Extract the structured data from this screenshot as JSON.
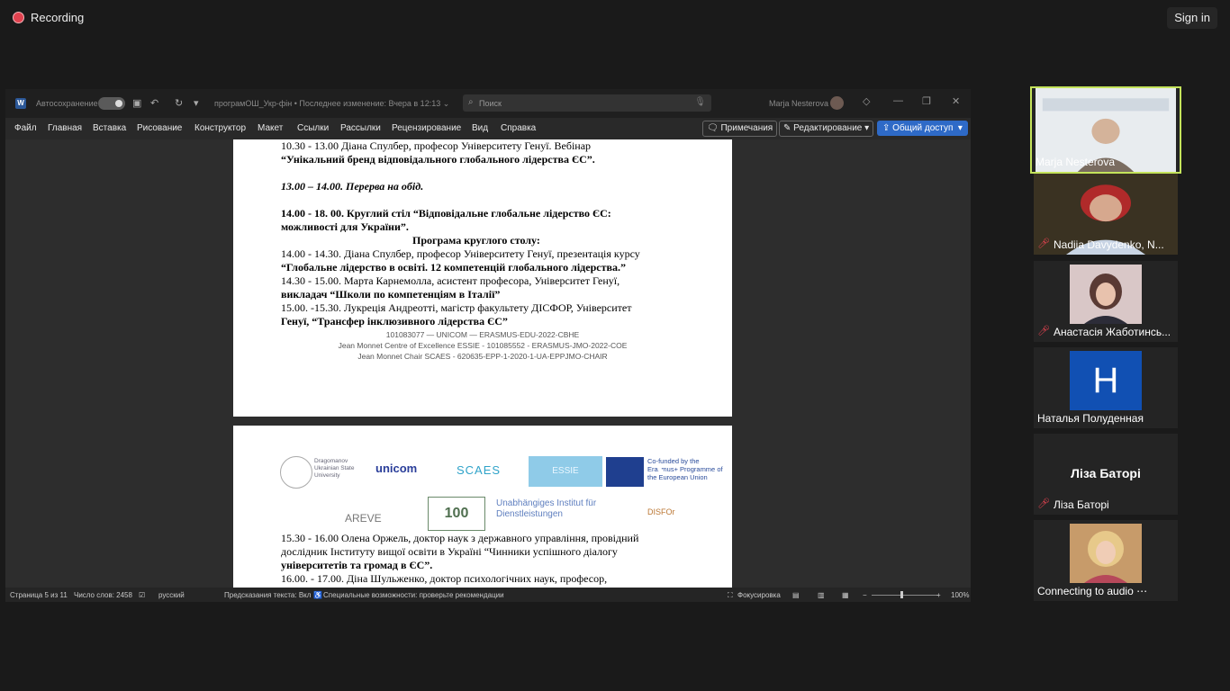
{
  "topbar": {
    "recording_label": "Recording",
    "signin_label": "Sign in"
  },
  "word": {
    "autosave_label": "Автосохранение",
    "doc_title": "програмОШ_Укр-фін • Последнее изменение: Вчера в 12:13 ⌄",
    "search_placeholder": "Поиск",
    "user_name": "Marja Nesterova",
    "tabs": [
      "Файл",
      "Главная",
      "Вставка",
      "Рисование",
      "Конструктор",
      "Макет",
      "Ссылки",
      "Рассылки",
      "Рецензирование",
      "Вид",
      "Справка"
    ],
    "comments_label": "Примечания",
    "editing_label": "Редактирование",
    "share_label": "Общий доступ",
    "page1_lines": [
      "10.30 - 13.00  Діана Спулбер, професор Університету Генуї. Вебінар",
      "“Унікальний бренд  відповідального глобального лідерства ЄС”.",
      "13.00 – 14.00. Перерва на обід.",
      " 14.00 - 18. 00. Круглий стіл  “Відповідальне глобальне лідерство ЄС:",
      "можливості для України”.",
      "Програма круглого столу:",
      "14.00 - 14.30.  Діана Спулбер, професор Університету Генуї, презентація курсу",
      "“Глобальне лідерство в освіті. 12 компетенцій глобального лідерства.”",
      "14.30  -  15.00.  Марта Карнемолла, асистент професора, Університет Генуї,",
      "викладач  “Школи по компетенціям в Італії”",
      "15.00.  -15.30. Лукреція Андреотті, магістр факультету ДІСФОР, Університет",
      "Генуї, “Трансфер інклюзивного лідерства ЄС”"
    ],
    "page1_footer": [
      "101083077 — UNICOM —  ERASMUS-EDU-2022-CBHE",
      "Jean Monnet Centre of Excellence ESSIE - 101085552 - ERASMUS-JMO-2022-COE",
      "Jean Monnet Chair SCAES - 620635-EPP-1-2020-1-UA-EPPJMO-CHAIR"
    ],
    "logos": {
      "dragomanov": "Dragomanov Ukrainian State University",
      "unicom": "unicom",
      "scaes": "SCAES",
      "essie": "ESSIE",
      "eu": "Co-funded by the Erasmus+ Programme of the European Union",
      "areve": "AREVE",
      "hundred": "100",
      "institut": "Unabhängiges Institut für Dienstleistungen",
      "disfor": "DISFOr"
    },
    "page2_lines": [
      "15.30 - 16.00 Олена Оржель, доктор наук з державного управління, провідний",
      "дослідник Інституту вищої освіти в Україні  “Чинники успішного діалогу",
      "університетів та громад в ЄС”.",
      "16.00. - 17.00. Діна Шульженко, доктор психологічних наук, професор,"
    ],
    "status": {
      "page": "Страница 5 из 11",
      "words": "Число слов: 2458",
      "lang": "русский",
      "predict": "Предсказания текста: Вкл",
      "access": "Специальные возможности: проверьте рекомендации",
      "focus": "Фокусировка",
      "zoom": "100%"
    }
  },
  "participants": [
    {
      "name": "Marja Nesterova",
      "muted": false
    },
    {
      "name": "Nadiia Davydenko, N...",
      "muted": true
    },
    {
      "name": "Анастасія Жаботинсь...",
      "muted": true
    },
    {
      "name": "Наталья Полуденная",
      "muted": false,
      "initial": "H"
    },
    {
      "name": "Ліза Баторі",
      "muted": true,
      "big": "Ліза Баторі"
    },
    {
      "name": "Connecting to audio ⋯",
      "muted": false
    }
  ],
  "colors": {
    "accent": "#c4e35b",
    "share": "#2e6ac7",
    "avatar_bg": "#1150b3",
    "rec": "#e0424f"
  }
}
